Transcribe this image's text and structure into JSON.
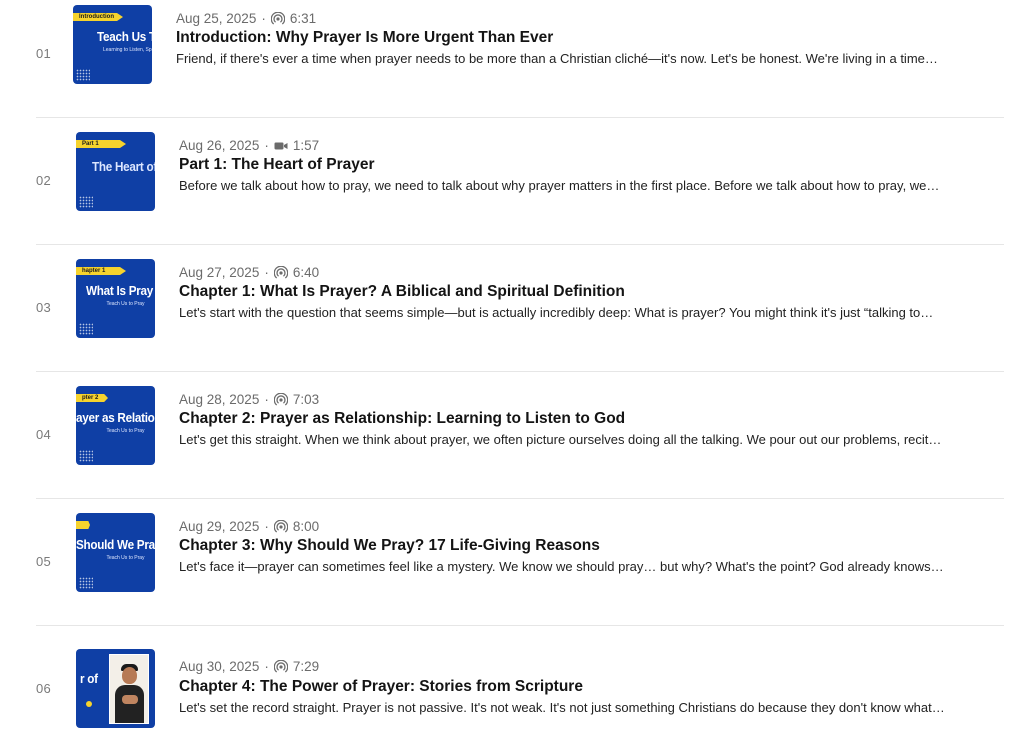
{
  "colors": {
    "thumbnail_bg": "#0f3fa5",
    "tag_yellow": "#f6d32d",
    "divider": "#e6e6e6",
    "meta_text": "#6b6b6b"
  },
  "episodes": [
    {
      "number": "01",
      "date": "Aug 25, 2025",
      "media_icon": "podcast-icon",
      "duration": "6:31",
      "title": "Introduction: Why Prayer Is More Urgent Than Ever",
      "description": "Friend, if there's ever a time when prayer needs to be more than a Christian cliché—it's now. Let's be honest. We're living in a time…",
      "thumb_tag": "Introduction",
      "thumb_big": "Teach Us T",
      "thumb_small": "Learning to Listen, Sp... in God's Pres..."
    },
    {
      "number": "02",
      "date": "Aug 26, 2025",
      "media_icon": "video-camera-icon",
      "duration": "1:57",
      "title": "Part 1: The Heart of Prayer",
      "description": "Before we talk about how to pray, we need to talk about why prayer matters in the first place. Before we talk about how to pray, we…",
      "thumb_tag": "Part 1",
      "thumb_big": "The Heart of",
      "thumb_small": ""
    },
    {
      "number": "03",
      "date": "Aug 27, 2025",
      "media_icon": "podcast-icon",
      "duration": "6:40",
      "title": "Chapter 1: What Is Prayer? A Biblical and Spiritual Definition",
      "description": "Let's start with the question that seems simple—but is actually incredibly deep: What is prayer? You might think it's just “talking to…",
      "thumb_tag": "hapter 1",
      "thumb_big": "What Is Pray",
      "thumb_small": "Teach Us to Pray"
    },
    {
      "number": "04",
      "date": "Aug 28, 2025",
      "media_icon": "podcast-icon",
      "duration": "7:03",
      "title": "Chapter 2: Prayer as Relationship: Learning to Listen to God",
      "description": "Let's get this straight. When we think about prayer, we often picture ourselves doing all the talking.  We pour out our problems, recit…",
      "thumb_tag": "pter 2",
      "thumb_big": "ayer as Relatio",
      "thumb_small": "Teach Us to Pray"
    },
    {
      "number": "05",
      "date": "Aug 29, 2025",
      "media_icon": "podcast-icon",
      "duration": "8:00",
      "title": "Chapter 3: Why Should We Pray? 17 Life-Giving Reasons",
      "description": "Let's face it—prayer can sometimes feel like a mystery. We know we should pray… but why? What's the point? God already knows…",
      "thumb_tag": "",
      "thumb_big": "Should We Pray",
      "thumb_small": "Teach Us to Pray"
    },
    {
      "number": "06",
      "date": "Aug 30, 2025",
      "media_icon": "podcast-icon",
      "duration": "7:29",
      "title": "Chapter 4: The Power of Prayer: Stories from Scripture",
      "description": "Let's set the record straight. Prayer is not passive. It's not weak. It's not just something Christians do because they don't know what…",
      "thumb_tag": "",
      "thumb_big": "r of",
      "thumb_small": ""
    }
  ]
}
